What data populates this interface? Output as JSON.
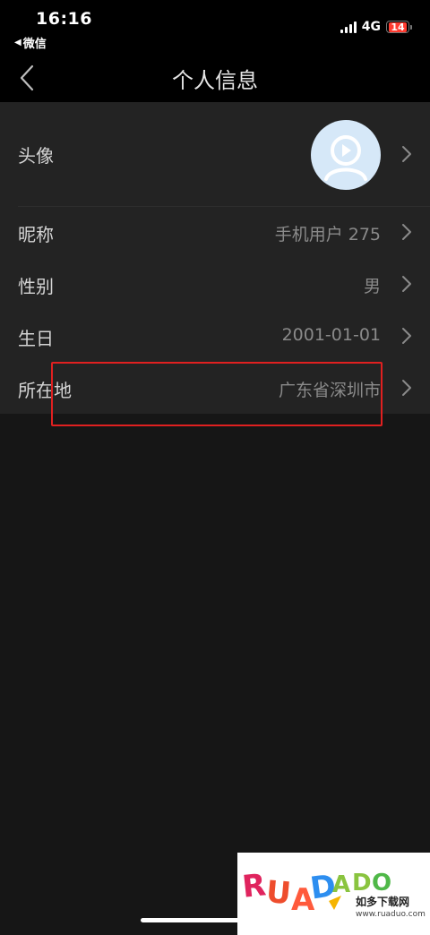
{
  "status_bar": {
    "time": "16:16",
    "back_app": "微信",
    "network": "4G",
    "battery": "14"
  },
  "nav": {
    "title": "个人信息"
  },
  "profile": {
    "avatar_label": "头像",
    "nickname_label": "昵称",
    "nickname_value": "手机用户 275",
    "gender_label": "性别",
    "gender_value": "男",
    "birthday_label": "生日",
    "birthday_value": "2001-01-01",
    "location_label": "所在地",
    "location_value": "广东省深圳市"
  },
  "watermark": {
    "logo_text": "RUADADO",
    "site_cn": "如多下载网",
    "url": "www.ruaduo.com"
  },
  "colors": {
    "status_bg": "#000000",
    "list_bg": "#232323",
    "page_bg": "#161616",
    "highlight": "#e02020",
    "battery_low": "#ff3b30",
    "avatar_bg": "#d6e8f8"
  }
}
